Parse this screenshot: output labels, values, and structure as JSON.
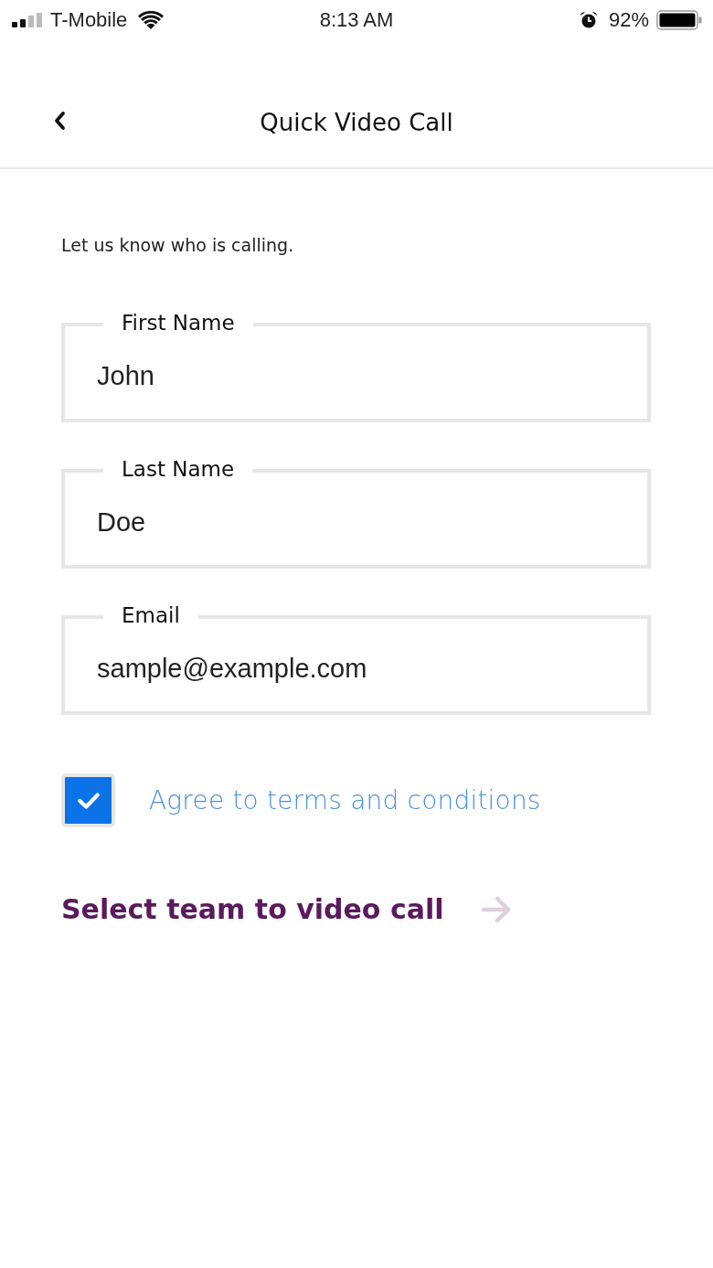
{
  "status_bar": {
    "carrier": "T-Mobile",
    "time": "8:13 AM",
    "battery_percent": "92%"
  },
  "nav_bar": {
    "title": "Quick Video Call"
  },
  "intro": "Let us know who is calling.",
  "fields": [
    {
      "label": "First Name",
      "value": "John"
    },
    {
      "label": "Last Name",
      "value": "Doe"
    },
    {
      "label": "Email",
      "value": "sample@example.com"
    }
  ],
  "terms": {
    "label": "Agree to terms and conditions",
    "checked": true
  },
  "next_action": {
    "label": "Select team to video call"
  }
}
